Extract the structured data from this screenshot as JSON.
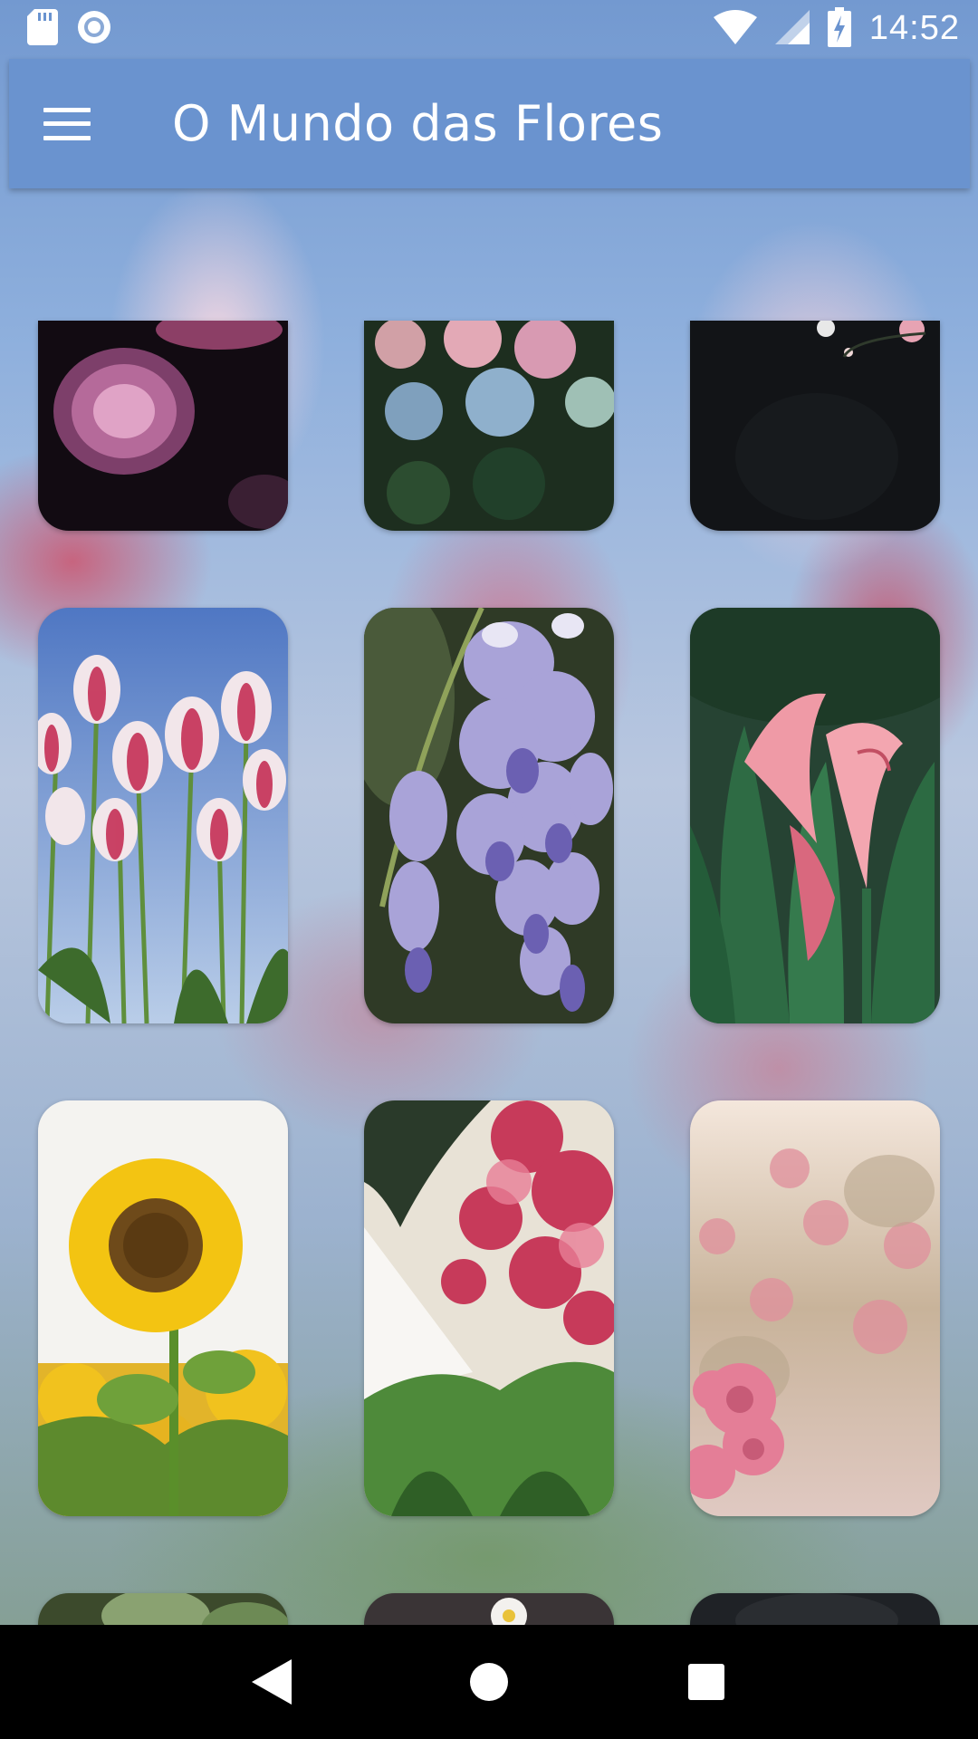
{
  "status_bar": {
    "time": "14:52",
    "icons": [
      "sd-card-icon",
      "sync-icon",
      "wifi-icon",
      "signal-icon",
      "battery-charging-icon"
    ]
  },
  "app_bar": {
    "title": "O Mundo das Flores",
    "menu_icon": "hamburger-menu-icon"
  },
  "colors": {
    "app_bar": "#6a93cf",
    "status_text": "#ffffff",
    "nav_bar": "#000000"
  },
  "gallery": {
    "images": [
      {
        "subject": "peony"
      },
      {
        "subject": "hydrangea"
      },
      {
        "subject": "dark-flowers"
      },
      {
        "subject": "tulips"
      },
      {
        "subject": "wisteria"
      },
      {
        "subject": "calla-lily"
      },
      {
        "subject": "sunflower"
      },
      {
        "subject": "bougainvillea"
      },
      {
        "subject": "roses"
      },
      {
        "subject": "partial-1"
      },
      {
        "subject": "partial-2"
      },
      {
        "subject": "partial-3"
      }
    ]
  },
  "nav_bar": {
    "back_icon": "back-triangle-icon",
    "home_icon": "home-circle-icon",
    "recents_icon": "recents-square-icon"
  }
}
